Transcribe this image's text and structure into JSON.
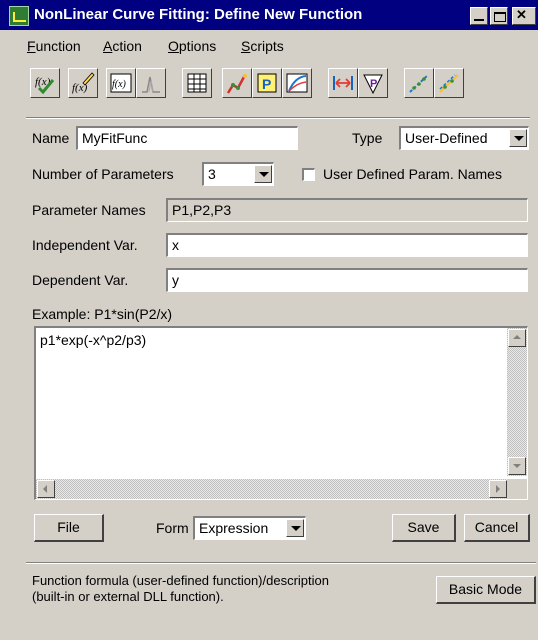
{
  "window": {
    "title": "NonLinear Curve Fitting:  Define New Function"
  },
  "menu": [
    {
      "hotkey": "F",
      "rest": "unction"
    },
    {
      "hotkey": "A",
      "rest": "ction"
    },
    {
      "hotkey": "O",
      "rest": "ptions"
    },
    {
      "hotkey": "S",
      "rest": "cripts"
    }
  ],
  "toolbar": {
    "icons": [
      "new-function-icon",
      "edit-function-icon",
      "function-browser-icon",
      "simulate-curve-icon",
      "parameters-table-icon",
      "select-dataset-icon",
      "parameter-worksheet-icon",
      "fit-curve-icon",
      "data-range-icon",
      "weighting-icon",
      "iterate-once-icon",
      "iterate-many-icon"
    ]
  },
  "form": {
    "name_label": "Name",
    "name_value": "MyFitFunc",
    "type_label": "Type",
    "type_value": "User-Defined",
    "num_params_label": "Number of Parameters",
    "num_params_value": "3",
    "user_param_names_label": "User Defined Param. Names",
    "param_names_label": "Parameter Names",
    "param_names_value": "P1,P2,P3",
    "indep_label": "Independent Var.",
    "indep_value": "x",
    "dep_label": "Dependent Var.",
    "dep_value": "y",
    "example_label": "Example: P1*sin(P2/x)",
    "expression": "p1*exp(-x^p2/p3)"
  },
  "buttons": {
    "file": "File",
    "form_label": "Form",
    "form_value": "Expression",
    "save": "Save",
    "cancel": "Cancel",
    "basic_mode": "Basic Mode"
  },
  "status": {
    "line1": "Function formula (user-defined function)/description",
    "line2": "(built-in or external DLL function)."
  }
}
